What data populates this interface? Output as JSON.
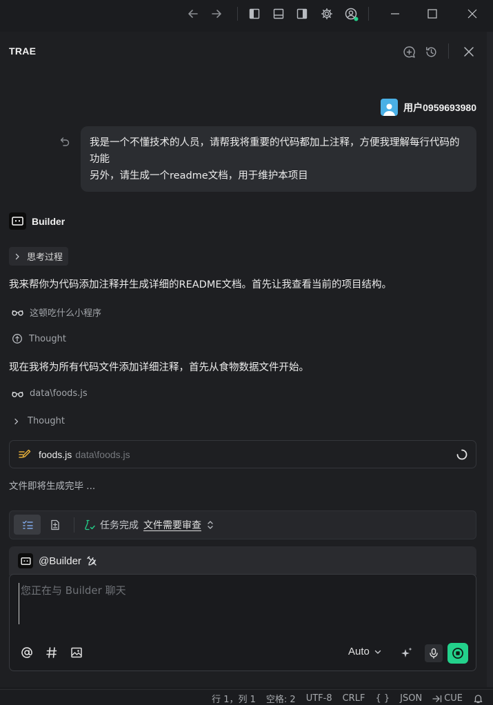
{
  "window": {
    "controls": [
      "back-icon",
      "forward-icon",
      "layout-left-icon",
      "layout-bottom-icon",
      "layout-right-icon",
      "gear-icon",
      "account-icon",
      "minimize-icon",
      "maximize-icon",
      "close-icon"
    ]
  },
  "panel": {
    "title": "TRAE",
    "actions": [
      "new-chat-icon",
      "history-icon",
      "close-icon"
    ]
  },
  "user": {
    "name": "用户0959693980",
    "message_lines": [
      "我是一个不懂技术的人员，请帮我将重要的代码都加上注释，方便我理解每行代码的功能",
      "另外，请生成一个readme文档，用于维护本项目"
    ]
  },
  "assistant": {
    "name": "Builder",
    "thinking_label": "思考过程",
    "intro": "我来帮你为代码添加注释并生成详细的README文档。首先让我查看当前的项目结构。",
    "view_folder": "这顿吃什么小程序",
    "thought_1": "Thought",
    "next_step": "现在我将为所有代码文件添加详细注释，首先从食物数据文件开始。",
    "view_file": "data\\foods.js",
    "thought_2": "Thought",
    "edit_card": {
      "file_name": "foods.js",
      "file_path": "data\\foods.js"
    },
    "generating_status": "文件即将生成完毕 ..."
  },
  "task_bar": {
    "status": "任务完成",
    "review_link": "文件需要审查"
  },
  "composer": {
    "agent_mention": "@Builder",
    "placeholder": "您正在与 Builder 聊天",
    "value": "",
    "model": "Auto",
    "accent_color": "#23d18b"
  },
  "status_bar": {
    "position": "行 1，列 1",
    "spaces": "空格: 2",
    "encoding": "UTF-8",
    "eol": "CRLF",
    "braces": "{ }",
    "language": "JSON",
    "cue": "CUE"
  }
}
